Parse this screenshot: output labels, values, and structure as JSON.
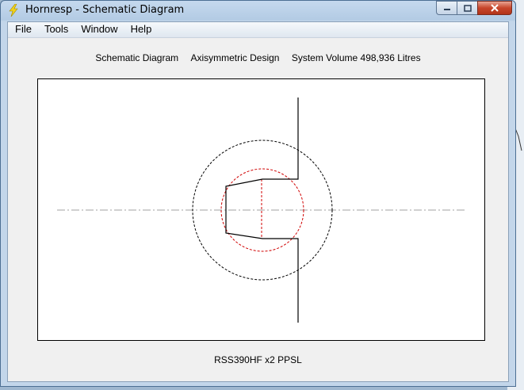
{
  "window": {
    "title": "Hornresp - Schematic Diagram",
    "caption_buttons": [
      "minimize",
      "maximize",
      "close"
    ]
  },
  "menu": {
    "items": [
      {
        "label": "File"
      },
      {
        "label": "Tools"
      },
      {
        "label": "Window"
      },
      {
        "label": "Help"
      }
    ]
  },
  "header": {
    "part1": "Schematic Diagram",
    "part2": "Axisymmetric Design",
    "part3": "System Volume 498,936 Litres"
  },
  "footer": {
    "label": "RSS390HF x2 PPSL"
  },
  "colors": {
    "outline": "#000000",
    "driver_circle": "#d00000",
    "axis_line": "#a0a0a0"
  }
}
